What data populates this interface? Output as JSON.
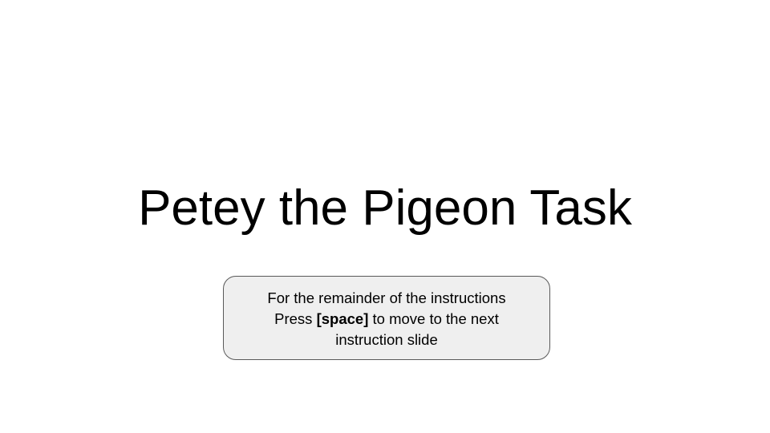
{
  "slide": {
    "title": "Petey the Pigeon Task",
    "instruction": {
      "line1": "For the remainder of the instructions",
      "line2_prefix": "Press ",
      "line2_key": "[space]",
      "line2_suffix": " to move to the next",
      "line3": "instruction slide"
    }
  }
}
